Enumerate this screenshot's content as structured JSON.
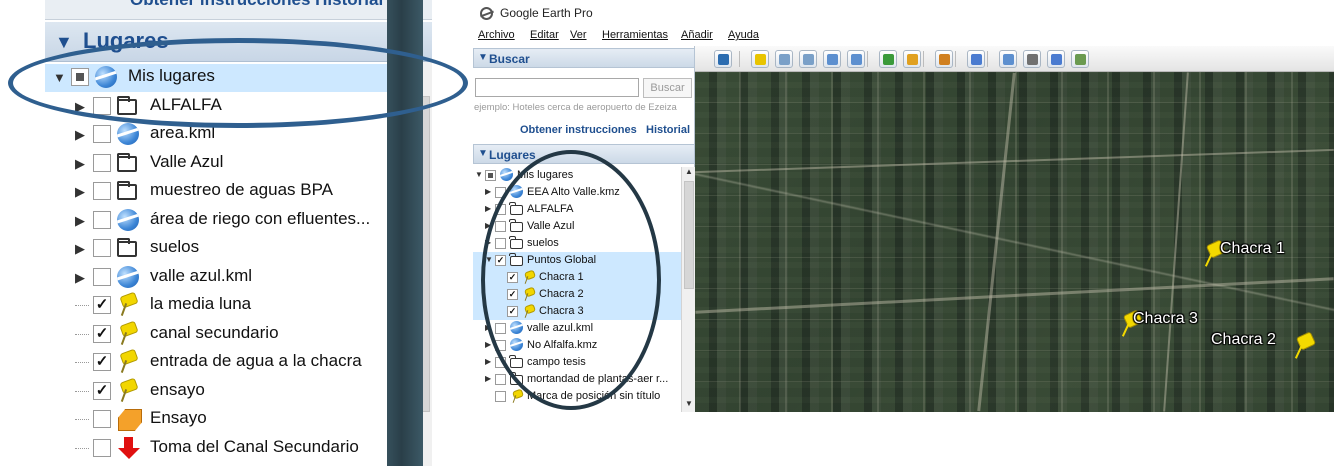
{
  "left_panel": {
    "top_cut_text": "Obtener instrucciones  Historial",
    "section_title": "Lugares",
    "items": [
      {
        "label": "Mis lugares",
        "icon": "globe-icon",
        "check": "partial",
        "expander": "expanded"
      },
      {
        "label": "ALFALFA",
        "icon": "folder-icon",
        "check": "unchecked",
        "expander": "collapsed"
      },
      {
        "label": "area.kml",
        "icon": "globe-icon",
        "check": "unchecked",
        "expander": "collapsed"
      },
      {
        "label": "Valle Azul",
        "icon": "folder-icon",
        "check": "unchecked",
        "expander": "collapsed"
      },
      {
        "label": "muestreo de aguas BPA",
        "icon": "folder-icon",
        "check": "unchecked",
        "expander": "collapsed"
      },
      {
        "label": "área de riego con efluentes...",
        "icon": "globe-icon",
        "check": "unchecked",
        "expander": "collapsed"
      },
      {
        "label": "suelos",
        "icon": "folder-icon",
        "check": "unchecked",
        "expander": "collapsed"
      },
      {
        "label": "valle azul.kml",
        "icon": "globe-icon",
        "check": "unchecked",
        "expander": "collapsed"
      },
      {
        "label": "la media luna",
        "icon": "pushpin-icon",
        "check": "checked",
        "expander": "none"
      },
      {
        "label": "canal secundario",
        "icon": "pushpin-icon",
        "check": "checked",
        "expander": "none"
      },
      {
        "label": "entrada de agua a la chacra",
        "icon": "pushpin-icon",
        "check": "checked",
        "expander": "none"
      },
      {
        "label": "ensayo",
        "icon": "pushpin-icon",
        "check": "checked",
        "expander": "none"
      },
      {
        "label": "Ensayo",
        "icon": "polygon-icon",
        "check": "unchecked",
        "expander": "none"
      },
      {
        "label": "Toma del Canal Secundario",
        "icon": "red-arrow-icon",
        "check": "unchecked",
        "expander": "none"
      }
    ]
  },
  "window": {
    "title": "Google Earth Pro",
    "menu": [
      "Archivo",
      "Editar",
      "Ver",
      "Herramientas",
      "Añadir",
      "Ayuda"
    ]
  },
  "search": {
    "section_title": "Buscar",
    "input_value": "",
    "button_label": "Buscar",
    "example": "ejemplo: Hoteles cerca de aeropuerto de Ezeiza",
    "get_directions": "Obtener instrucciones",
    "history": "Historial"
  },
  "places": {
    "section_title": "Lugares",
    "items": [
      {
        "label": "Mis lugares",
        "icon": "globe-icon",
        "check": "partial",
        "expander": "expanded",
        "highlight": false
      },
      {
        "label": "EEA Alto Valle.kmz",
        "icon": "globe-icon",
        "check": "unchecked",
        "expander": "collapsed",
        "highlight": false
      },
      {
        "label": "ALFALFA",
        "icon": "folder-icon",
        "check": "unchecked",
        "expander": "collapsed",
        "highlight": false
      },
      {
        "label": "Valle Azul",
        "icon": "folder-icon",
        "check": "unchecked",
        "expander": "collapsed",
        "highlight": false
      },
      {
        "label": "suelos",
        "icon": "folder-icon",
        "check": "unchecked",
        "expander": "collapsed",
        "highlight": false
      },
      {
        "label": "Puntos Global",
        "icon": "folder-open-icon",
        "check": "checked",
        "expander": "expanded",
        "highlight": true
      },
      {
        "label": "Chacra 1",
        "icon": "pushpin-icon",
        "check": "checked",
        "expander": "none",
        "highlight": true
      },
      {
        "label": "Chacra 2",
        "icon": "pushpin-icon",
        "check": "checked",
        "expander": "none",
        "highlight": true
      },
      {
        "label": "Chacra 3",
        "icon": "pushpin-icon",
        "check": "checked",
        "expander": "none",
        "highlight": true
      },
      {
        "label": "valle azul.kml",
        "icon": "globe-icon",
        "check": "unchecked",
        "expander": "collapsed",
        "highlight": false
      },
      {
        "label": "No Alfalfa.kmz",
        "icon": "globe-icon",
        "check": "unchecked",
        "expander": "collapsed",
        "highlight": false
      },
      {
        "label": "campo tesis",
        "icon": "folder-icon",
        "check": "unchecked",
        "expander": "collapsed",
        "highlight": false
      },
      {
        "label": "mortandad de plantas-aer r...",
        "icon": "folder-icon",
        "check": "unchecked",
        "expander": "collapsed",
        "highlight": false
      },
      {
        "label": "Marca de posición sin título",
        "icon": "pushpin-icon",
        "check": "unchecked",
        "expander": "none",
        "highlight": false
      }
    ]
  },
  "toolbar": {
    "buttons": [
      {
        "icon": "sidebar-toggle-icon",
        "color": "#2b6cb0"
      },
      {
        "icon": "add-placemark-icon",
        "color": "#e8c400"
      },
      {
        "icon": "add-polygon-icon",
        "color": "#7aa0c8"
      },
      {
        "icon": "add-path-icon",
        "color": "#7aa0c8"
      },
      {
        "icon": "add-overlay-icon",
        "color": "#5c8fcf"
      },
      {
        "icon": "record-tour-icon",
        "color": "#5c8fcf"
      },
      {
        "icon": "historical-imagery-icon",
        "color": "#3a9a3a"
      },
      {
        "icon": "sunlight-icon",
        "color": "#e0a020"
      },
      {
        "icon": "switch-planet-icon",
        "color": "#d08020"
      },
      {
        "icon": "ruler-icon",
        "color": "#4a7bd0"
      },
      {
        "icon": "email-icon",
        "color": "#5c8fcf"
      },
      {
        "icon": "print-icon",
        "color": "#707070"
      },
      {
        "icon": "save-image-icon",
        "color": "#4a7bd0"
      },
      {
        "icon": "view-in-maps-icon",
        "color": "#6a9a50"
      }
    ]
  },
  "map": {
    "placemarks": [
      {
        "label": "Chacra 1"
      },
      {
        "label": "Chacra 2"
      },
      {
        "label": "Chacra 3"
      }
    ]
  }
}
